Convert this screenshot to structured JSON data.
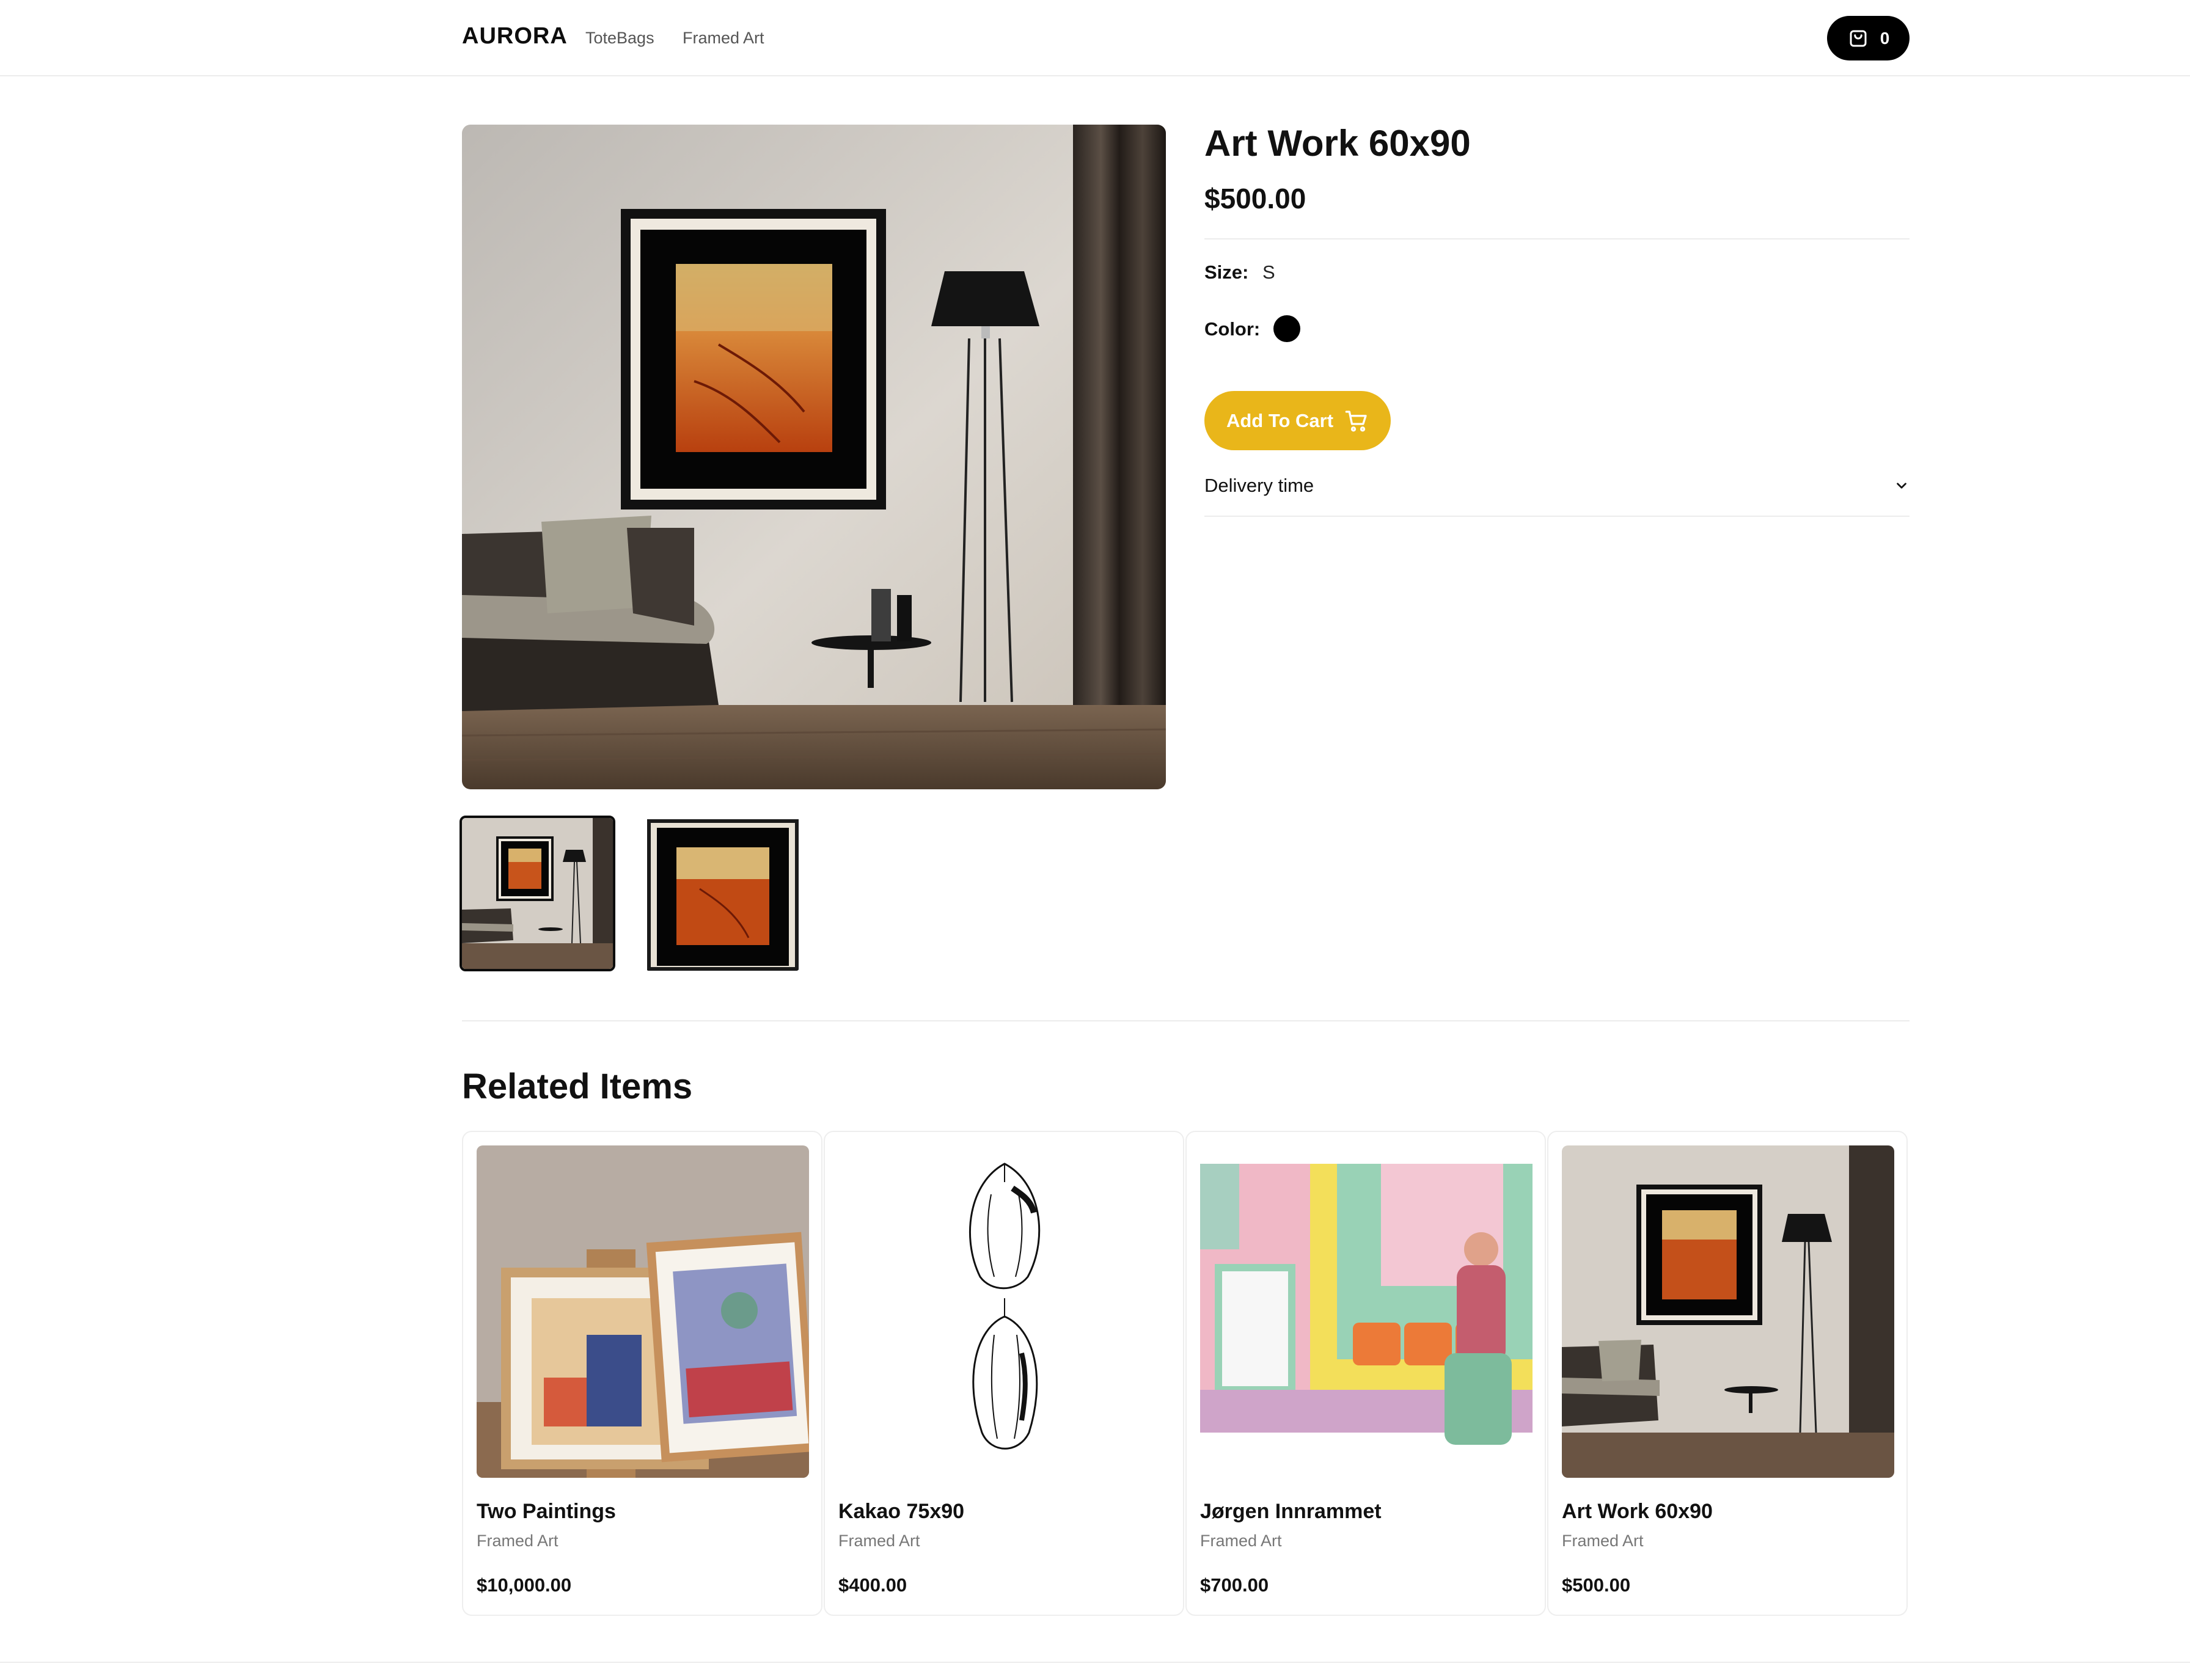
{
  "header": {
    "logo": "AURORA",
    "nav": [
      {
        "label": "ToteBags"
      },
      {
        "label": "Framed Art"
      }
    ],
    "cart_count": "0"
  },
  "product": {
    "title": "Art Work 60x90",
    "price": "$500.00",
    "size_label": "Size:",
    "size_value": "S",
    "color_label": "Color:",
    "color_value": "#000000",
    "add_to_cart": "Add To Cart",
    "delivery_label": "Delivery time"
  },
  "related": {
    "title": "Related Items",
    "items": [
      {
        "name": "Two Paintings",
        "category": "Framed Art",
        "price": "$10,000.00"
      },
      {
        "name": "Kakao 75x90",
        "category": "Framed Art",
        "price": "$400.00"
      },
      {
        "name": "Jørgen Innrammet",
        "category": "Framed Art",
        "price": "$700.00"
      },
      {
        "name": "Art Work 60x90",
        "category": "Framed Art",
        "price": "$500.00"
      }
    ]
  },
  "colors": {
    "accent": "#e9b61a",
    "text": "#111111",
    "muted": "#777777"
  }
}
